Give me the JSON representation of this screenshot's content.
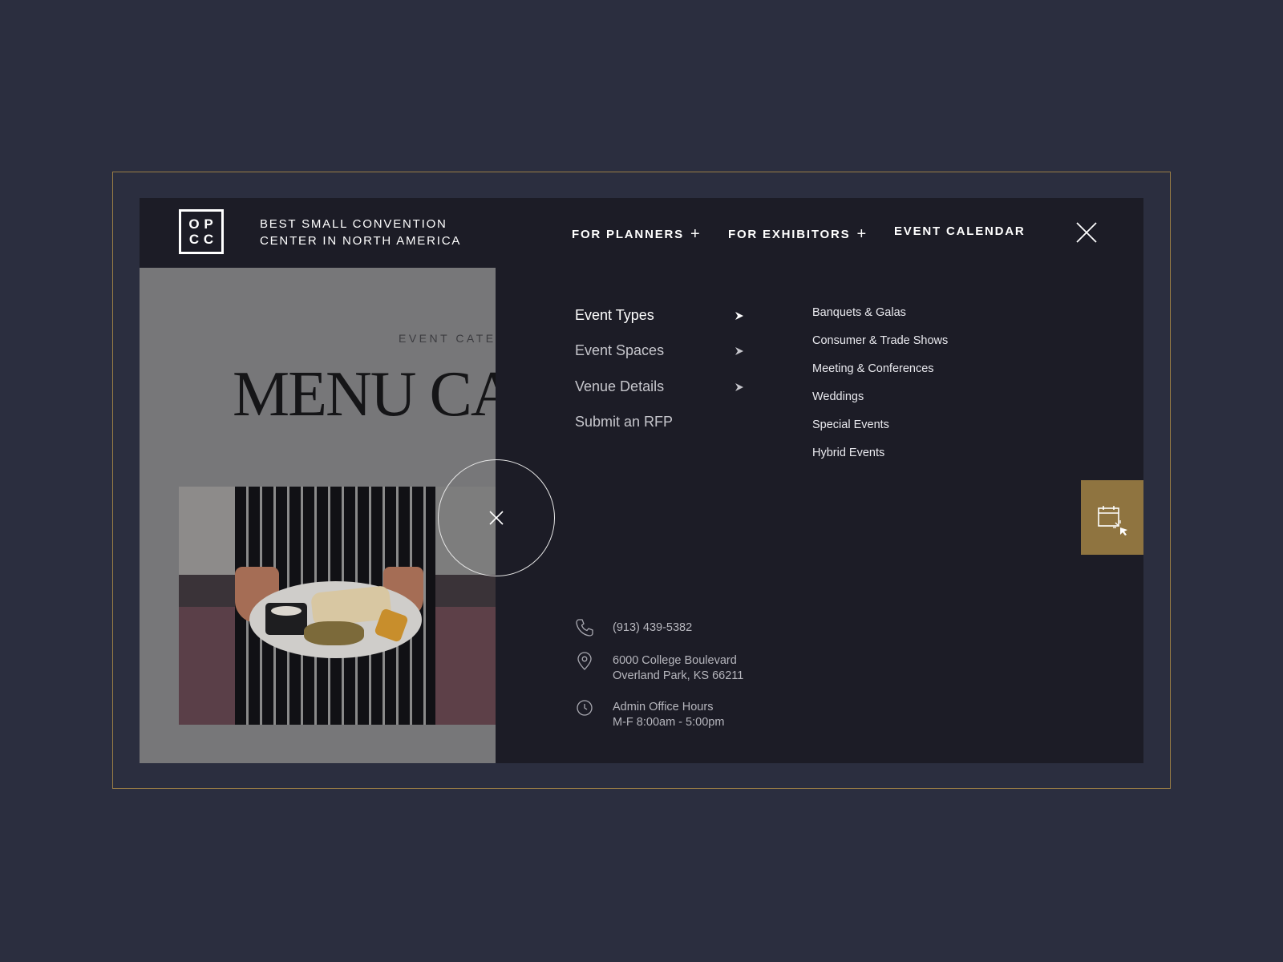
{
  "header": {
    "logo_letters": [
      "O",
      "P",
      "C",
      "C"
    ],
    "tagline_line1": "BEST SMALL CONVENTION",
    "tagline_line2": "CENTER IN NORTH AMERICA",
    "nav": [
      {
        "label": "FOR PLANNERS",
        "expand": "+"
      },
      {
        "label": "FOR EXHIBITORS",
        "expand": "+"
      },
      {
        "label": "EVENT CALENDAR"
      }
    ],
    "close_icon": "close-icon"
  },
  "page_behind": {
    "eyebrow": "EVENT CATER",
    "headline": "MENU CA"
  },
  "menu": {
    "primary": [
      {
        "label": "Event Types",
        "active": true
      },
      {
        "label": "Event Spaces"
      },
      {
        "label": "Venue Details"
      },
      {
        "label": "Submit an RFP"
      }
    ],
    "submenu": [
      "Banquets & Galas",
      "Consumer & Trade Shows",
      "Meeting & Conferences",
      "Weddings",
      "Special Events",
      "Hybrid Events"
    ]
  },
  "contact": {
    "phone": "(913) 439-5382",
    "address_line1": "6000 College Boulevard",
    "address_line2": "Overland Park, KS 66211",
    "hours_line1": "Admin Office Hours",
    "hours_line2": "M-F 8:00am - 5:00pm"
  },
  "colors": {
    "background": "#2b2e3f",
    "panel": "#1c1c26",
    "accent_gold": "#8f7440",
    "frame_gold": "#9a7d45"
  }
}
